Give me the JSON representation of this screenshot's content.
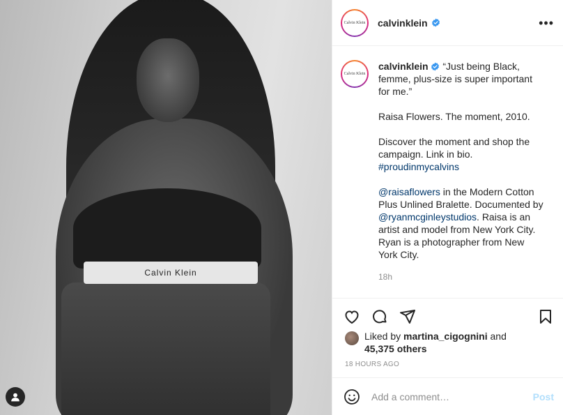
{
  "post": {
    "brand_logo_text": "Calvin Klein",
    "waistband_text": "Calvin Klein",
    "username": "calvinklein",
    "more_label": "•••",
    "caption": {
      "username": "calvinklein",
      "quote": "“Just being Black, femme, plus-size is super important for me.”",
      "line2": "Raisa Flowers. The moment, 2010.",
      "line3": "Discover the moment and shop the campaign. Link in bio.",
      "hashtag": "#proudinmycalvins",
      "mention1": "@raisaflowers",
      "text_a": " in the Modern Cotton Plus Unlined Bralette. Documented by ",
      "mention2": "@ryanmcginleystudios",
      "text_b": ". Raisa is an artist and model from New York City. Ryan is a photographer from New York City.",
      "time": "18h"
    },
    "likes": {
      "prefix": "Liked by ",
      "user": "martina_cigognini",
      "and": " and",
      "others": "45,375 others"
    },
    "time_ago": "18 HOURS AGO",
    "comment": {
      "placeholder": "Add a comment…",
      "post_label": "Post"
    }
  },
  "colors": {
    "verified": "#3897f0",
    "link": "#00376b",
    "post_disabled": "#b2dffc",
    "muted": "#8e8e8e"
  },
  "icons": [
    "user-tag-icon",
    "verified-icon",
    "more-icon",
    "heart-icon",
    "comment-icon",
    "share-icon",
    "bookmark-icon",
    "emoji-icon"
  ]
}
